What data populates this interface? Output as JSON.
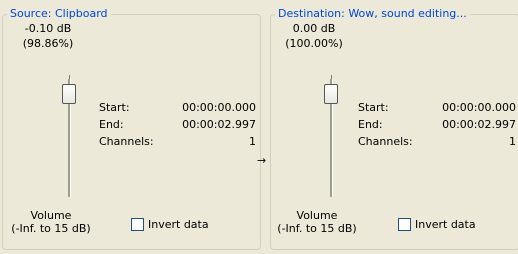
{
  "source": {
    "legend": "Source: Clipboard",
    "db": "-0.10 dB",
    "percent": "(98.86%)",
    "start_label": "Start:",
    "start_value": "00:00:00.000",
    "end_label": "End:",
    "end_value": "00:00:02.997",
    "channels_label": "Channels:",
    "channels_value": "1",
    "volume_label": "Volume",
    "volume_range": "(-Inf. to 15 dB)",
    "invert_label": "Invert data"
  },
  "destination": {
    "legend": "Destination: Wow, sound editing...",
    "db": "0.00 dB",
    "percent": "(100.00%)",
    "start_label": "Start:",
    "start_value": "00:00:00.000",
    "end_label": "End:",
    "end_value": "00:00:02.997",
    "channels_label": "Channels:",
    "channels_value": "1",
    "volume_label": "Volume",
    "volume_range": "(-Inf. to 15 dB)",
    "invert_label": "Invert data"
  },
  "colors": {
    "legend": "#0046D5",
    "background": "#ECE9D8"
  },
  "icons": {
    "arrow": "arrow-right-icon"
  }
}
